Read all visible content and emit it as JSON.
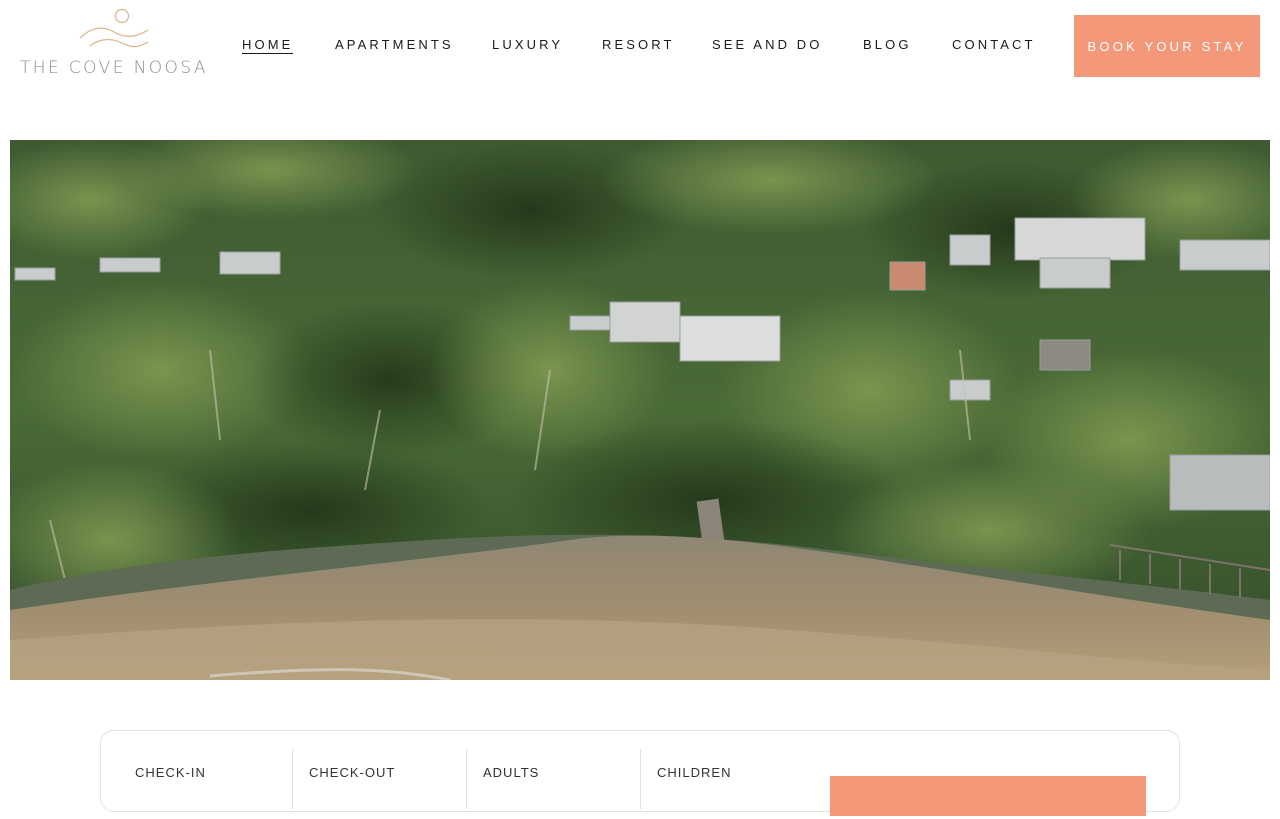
{
  "header": {
    "logo_text": "THE COVE NOOSA",
    "nav": [
      {
        "label": "HOME",
        "active": true
      },
      {
        "label": "APARTMENTS"
      },
      {
        "label": "LUXURY"
      },
      {
        "label": "RESORT"
      },
      {
        "label": "SEE AND DO"
      },
      {
        "label": "BLOG"
      },
      {
        "label": "CONTACT"
      }
    ],
    "book_label": "BOOK YOUR STAY"
  },
  "hero": {
    "image_kind": "aerial-photo"
  },
  "booking": {
    "fields": [
      {
        "label": "CHECK-IN"
      },
      {
        "label": "CHECK-OUT"
      },
      {
        "label": "ADULTS"
      },
      {
        "label": "CHILDREN"
      }
    ]
  },
  "colors": {
    "accent": "#f4987a",
    "logo_gray": "#8a8e92",
    "logo_gold": "#d9b48a",
    "nav_text": "#1a1a1a"
  }
}
